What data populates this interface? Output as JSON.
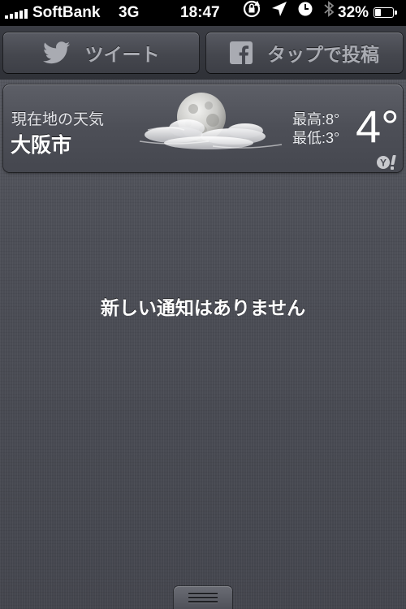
{
  "status_bar": {
    "carrier": "SoftBank",
    "network": "3G",
    "time": "18:47",
    "battery_percent": "32%",
    "battery_level": 0.32,
    "icons": [
      "signal-icon",
      "rotation-lock-icon",
      "location-icon",
      "alarm-icon",
      "bluetooth-icon",
      "battery-icon"
    ]
  },
  "share": {
    "tweet_label": "ツイート",
    "tweet_icon": "twitter-bird-icon",
    "post_label": "タップで投稿",
    "post_icon": "facebook-icon"
  },
  "weather": {
    "location_label": "現在地の天気",
    "city": "大阪市",
    "high": "最高:8°",
    "low": "最低:3°",
    "temperature": "4°",
    "condition_icon": "moon-cloud-icon",
    "provider_icon": "yahoo-icon"
  },
  "notifications": {
    "empty_message": "新しい通知はありません"
  },
  "colors": {
    "status_bar_bg": "#000000",
    "panel_bg": "#4a4c54",
    "button_text": "#a9abb2"
  }
}
